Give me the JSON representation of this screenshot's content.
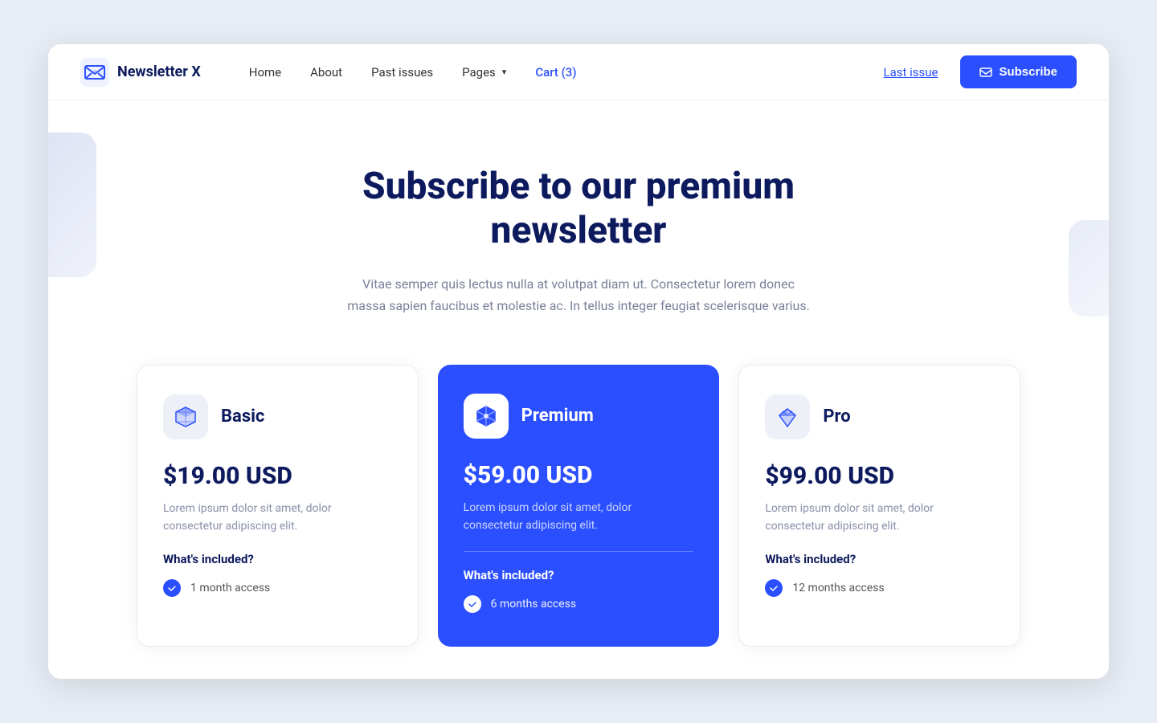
{
  "brand": {
    "name": "Newsletter X"
  },
  "nav": {
    "links": [
      {
        "label": "Home",
        "id": "home"
      },
      {
        "label": "About",
        "id": "about"
      },
      {
        "label": "Past issues",
        "id": "past-issues"
      },
      {
        "label": "Pages",
        "id": "pages",
        "hasDropdown": true
      },
      {
        "label": "Cart (3)",
        "id": "cart",
        "isAccent": true
      }
    ],
    "last_issue_label": "Last issue",
    "subscribe_label": "Subscribe"
  },
  "hero": {
    "title": "Subscribe to our premium newsletter",
    "subtitle": "Vitae semper quis lectus nulla at volutpat diam ut. Consectetur lorem donec massa sapien faucibus et molestie ac. In tellus integer feugiat scelerisque varius."
  },
  "pricing": {
    "cards": [
      {
        "id": "basic",
        "name": "Basic",
        "price": "$19.00 USD",
        "description": "Lorem ipsum dolor sit amet, dolor consectetur adipiscing elit.",
        "whats_included": "What's included?",
        "features": [
          "1 month access"
        ]
      },
      {
        "id": "premium",
        "name": "Premium",
        "price": "$59.00 USD",
        "description": "Lorem ipsum dolor sit amet, dolor consectetur adipiscing elit.",
        "whats_included": "What's included?",
        "features": [
          "6 months access"
        ]
      },
      {
        "id": "pro",
        "name": "Pro",
        "price": "$99.00 USD",
        "description": "Lorem ipsum dolor sit amet, dolor consectetur adipiscing elit.",
        "whats_included": "What's included?",
        "features": [
          "12 months access"
        ]
      }
    ]
  }
}
